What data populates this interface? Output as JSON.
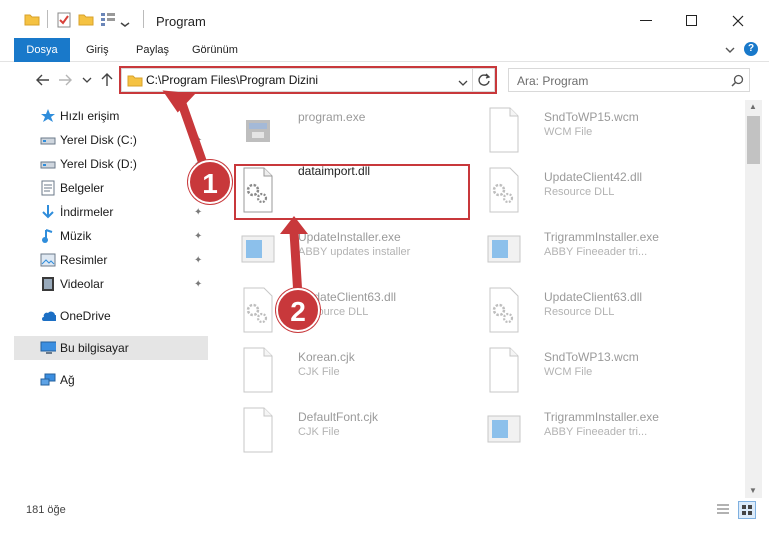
{
  "window": {
    "title": "Program",
    "minimize_glyph": "—",
    "maximize_glyph": "☐",
    "close_glyph": "✕"
  },
  "ribbon": {
    "tabs": [
      "Dosya",
      "Giriş",
      "Paylaş",
      "Görünüm"
    ]
  },
  "address": {
    "path": "C:\\Program Files\\Program Dizini"
  },
  "search": {
    "placeholder": "Ara: Program"
  },
  "sidebar": {
    "items": [
      {
        "label": "Hızlı erişim",
        "icon": "star-icon"
      },
      {
        "label": "Yerel Disk (C:)",
        "icon": "drive-icon"
      },
      {
        "label": "Yerel Disk (D:)",
        "icon": "drive-icon"
      },
      {
        "label": "Belgeler",
        "icon": "documents-icon"
      },
      {
        "label": "İndirmeler",
        "icon": "download-icon"
      },
      {
        "label": "Müzik",
        "icon": "music-icon"
      },
      {
        "label": "Resimler",
        "icon": "pictures-icon"
      },
      {
        "label": "Videolar",
        "icon": "videos-icon"
      },
      {
        "label": "OneDrive",
        "icon": "cloud-icon"
      },
      {
        "label": "Bu bilgisayar",
        "icon": "computer-icon"
      },
      {
        "label": "Ağ",
        "icon": "network-icon"
      }
    ]
  },
  "files": [
    {
      "name": "program.exe",
      "type": ""
    },
    {
      "name": "SndToWP15.wcm",
      "type": "WCM File"
    },
    {
      "name": "dataimport.dll",
      "type": ""
    },
    {
      "name": "UpdateClient42.dll",
      "type": "Resource DLL"
    },
    {
      "name": "UpdateInstaller.exe",
      "type": "ABBY updates installer"
    },
    {
      "name": "TrigrammInstaller.exe",
      "type": "ABBY Fineeader tri..."
    },
    {
      "name": "UpdateClient63.dll",
      "type": "Resource DLL"
    },
    {
      "name": "UpdateClient63.dll",
      "type": "Resource DLL"
    },
    {
      "name": "Korean.cjk",
      "type": "CJK File"
    },
    {
      "name": "SndToWP13.wcm",
      "type": "WCM File"
    },
    {
      "name": "DefaultFont.cjk",
      "type": "CJK File"
    },
    {
      "name": "TrigrammInstaller.exe",
      "type": "ABBY Fineeader tri..."
    }
  ],
  "status": {
    "count": "181 öğe"
  },
  "annotations": {
    "badge1": "1",
    "badge2": "2",
    "accent": "#c8383b"
  }
}
